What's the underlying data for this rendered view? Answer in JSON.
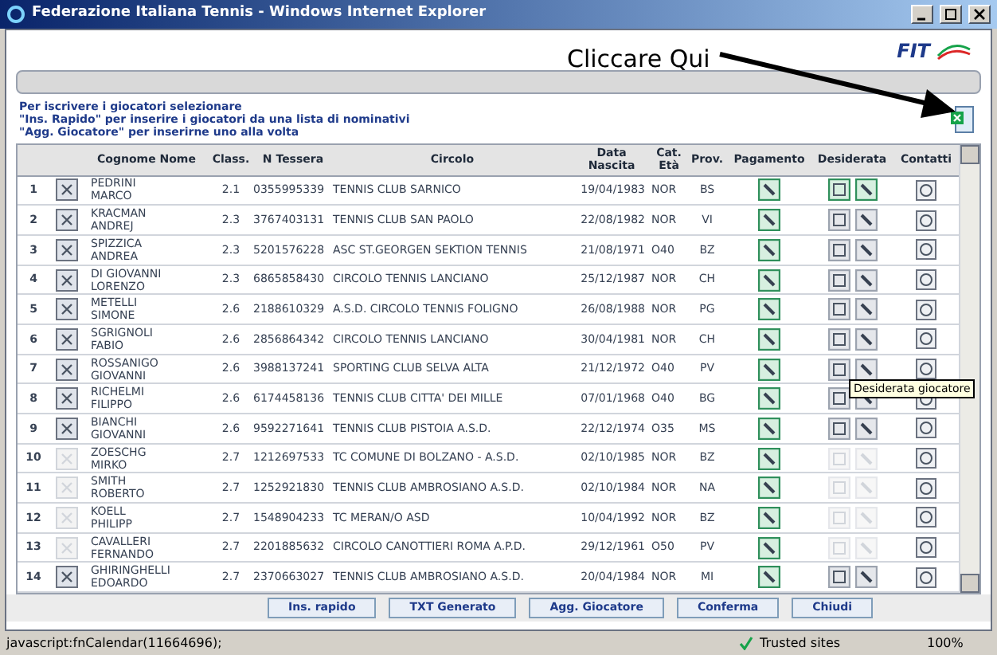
{
  "window": {
    "title": "Federazione Italiana Tennis - Windows Internet Explorer"
  },
  "logo": {
    "text": "FIT"
  },
  "annotation": {
    "text": "Cliccare Qui"
  },
  "instructions": [
    "Per iscrivere i giocatori selezionare",
    "\"Ins. Rapido\" per inserire i giocatori da una lista di nominativi",
    "\"Agg. Giocatore\" per inserirne uno alla volta"
  ],
  "table": {
    "columns": [
      "Cognome Nome",
      "Class.",
      "N Tessera",
      "Circolo",
      "Data Nascita",
      "Cat. Età",
      "Prov.",
      "Pagamento",
      "Desiderata",
      "Contatti"
    ],
    "rows": [
      {
        "index": "1",
        "surname": "PEDRINI",
        "name": "MARCO",
        "class": "2.1",
        "card": "0355995339",
        "club": "TENNIS CLUB SARNICO",
        "birth": "19/04/1983",
        "cat": "NOR",
        "prov": "BS",
        "removable": true,
        "desiderata": {
          "selected": true,
          "disabled": false
        }
      },
      {
        "index": "2",
        "surname": "KRACMAN",
        "name": "ANDREJ",
        "class": "2.3",
        "card": "3767403131",
        "club": "TENNIS CLUB SAN PAOLO",
        "birth": "22/08/1982",
        "cat": "NOR",
        "prov": "VI",
        "removable": true,
        "desiderata": {
          "selected": false,
          "disabled": false
        }
      },
      {
        "index": "3",
        "surname": "SPIZZICA",
        "name": "ANDREA",
        "class": "2.3",
        "card": "5201576228",
        "club": "ASC ST.GEORGEN SEKTION TENNIS",
        "birth": "21/08/1971",
        "cat": "O40",
        "prov": "BZ",
        "removable": true,
        "desiderata": {
          "selected": false,
          "disabled": false
        }
      },
      {
        "index": "4",
        "surname": "DI GIOVANNI",
        "name": "LORENZO",
        "class": "2.3",
        "card": "6865858430",
        "club": "CIRCOLO TENNIS LANCIANO",
        "birth": "25/12/1987",
        "cat": "NOR",
        "prov": "CH",
        "removable": true,
        "desiderata": {
          "selected": false,
          "disabled": false
        }
      },
      {
        "index": "5",
        "surname": "METELLI",
        "name": "SIMONE",
        "class": "2.6",
        "card": "2188610329",
        "club": "A.S.D. CIRCOLO TENNIS FOLIGNO",
        "birth": "26/08/1988",
        "cat": "NOR",
        "prov": "PG",
        "removable": true,
        "desiderata": {
          "selected": false,
          "disabled": false
        }
      },
      {
        "index": "6",
        "surname": "SGRIGNOLI",
        "name": "FABIO",
        "class": "2.6",
        "card": "2856864342",
        "club": "CIRCOLO TENNIS LANCIANO",
        "birth": "30/04/1981",
        "cat": "NOR",
        "prov": "CH",
        "removable": true,
        "desiderata": {
          "selected": false,
          "disabled": false
        }
      },
      {
        "index": "7",
        "surname": "ROSSANIGO",
        "name": "GIOVANNI",
        "class": "2.6",
        "card": "3988137241",
        "club": "SPORTING CLUB SELVA ALTA",
        "birth": "21/12/1972",
        "cat": "O40",
        "prov": "PV",
        "removable": true,
        "desiderata": {
          "selected": false,
          "disabled": false
        }
      },
      {
        "index": "8",
        "surname": "RICHELMI",
        "name": "FILIPPO",
        "class": "2.6",
        "card": "6174458136",
        "club": "TENNIS CLUB CITTA' DEI MILLE",
        "birth": "07/01/1968",
        "cat": "O40",
        "prov": "BG",
        "removable": true,
        "desiderata": {
          "selected": false,
          "disabled": false
        }
      },
      {
        "index": "9",
        "surname": "BIANCHI",
        "name": "GIOVANNI",
        "class": "2.6",
        "card": "9592271641",
        "club": "TENNIS CLUB PISTOIA A.S.D.",
        "birth": "22/12/1974",
        "cat": "O35",
        "prov": "MS",
        "removable": true,
        "desiderata": {
          "selected": false,
          "disabled": false
        }
      },
      {
        "index": "10",
        "surname": "ZOESCHG",
        "name": "MIRKO",
        "class": "2.7",
        "card": "1212697533",
        "club": "TC COMUNE DI BOLZANO - A.S.D.",
        "birth": "02/10/1985",
        "cat": "NOR",
        "prov": "BZ",
        "removable": false,
        "desiderata": {
          "selected": false,
          "disabled": true
        }
      },
      {
        "index": "11",
        "surname": "SMITH",
        "name": "ROBERTO",
        "class": "2.7",
        "card": "1252921830",
        "club": "TENNIS CLUB AMBROSIANO A.S.D.",
        "birth": "02/10/1984",
        "cat": "NOR",
        "prov": "NA",
        "removable": false,
        "desiderata": {
          "selected": false,
          "disabled": true
        }
      },
      {
        "index": "12",
        "surname": "KOELL",
        "name": "PHILIPP",
        "class": "2.7",
        "card": "1548904233",
        "club": "TC MERAN/O ASD",
        "birth": "10/04/1992",
        "cat": "NOR",
        "prov": "BZ",
        "removable": false,
        "desiderata": {
          "selected": false,
          "disabled": true
        }
      },
      {
        "index": "13",
        "surname": "CAVALLERI",
        "name": "FERNANDO",
        "class": "2.7",
        "card": "2201885632",
        "club": "CIRCOLO CANOTTIERI ROMA A.P.D.",
        "birth": "29/12/1961",
        "cat": "O50",
        "prov": "PV",
        "removable": false,
        "desiderata": {
          "selected": false,
          "disabled": true
        }
      },
      {
        "index": "14",
        "surname": "GHIRINGHELLI",
        "name": "EDOARDO",
        "class": "2.7",
        "card": "2370663027",
        "club": "TENNIS CLUB AMBROSIANO A.S.D.",
        "birth": "20/04/1984",
        "cat": "NOR",
        "prov": "MI",
        "removable": true,
        "desiderata": {
          "selected": false,
          "disabled": false
        }
      }
    ]
  },
  "tooltip": {
    "text": "Desiderata giocatore"
  },
  "buttons": [
    "Ins. rapido",
    "TXT Generato",
    "Agg. Giocatore",
    "Conferma",
    "Chiudi"
  ],
  "status_bar": {
    "url": "javascript:fnCalendar(11664696);",
    "zone": "Trusted sites",
    "zoom": "100%"
  }
}
